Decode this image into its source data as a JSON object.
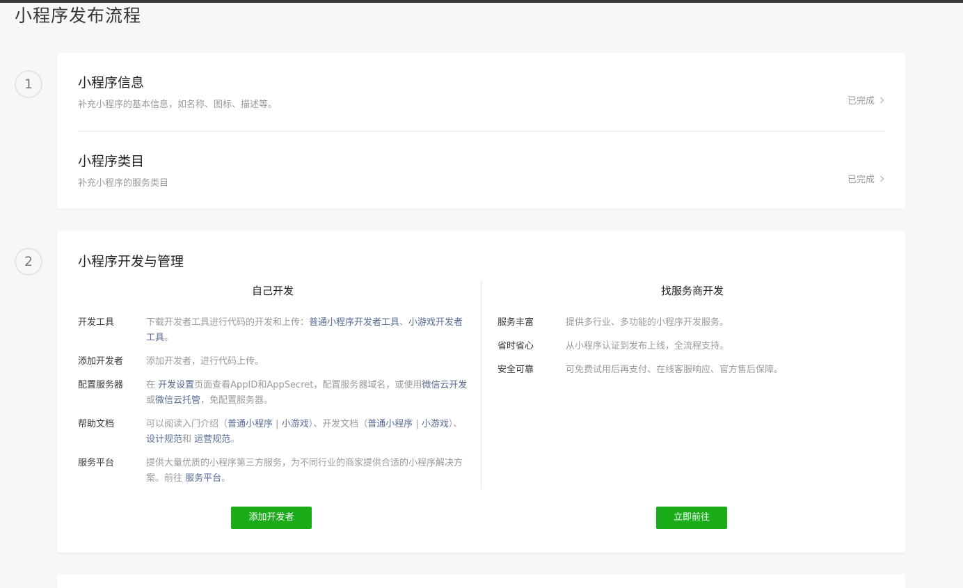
{
  "page": {
    "title": "小程序发布流程"
  },
  "step1": {
    "number": "1",
    "rows": [
      {
        "title": "小程序信息",
        "desc": "补充小程序的基本信息，如名称、图标、描述等。",
        "status": "已完成"
      },
      {
        "title": "小程序类目",
        "desc": "补充小程序的服务类目",
        "status": "已完成"
      }
    ]
  },
  "step2": {
    "number": "2",
    "title": "小程序开发与管理",
    "left": {
      "title": "自己开发",
      "items": [
        {
          "label": "开发工具",
          "t1": "下载开发者工具进行代码的开发和上传：",
          "l1": "普通小程序开发者工具",
          "t2": "、",
          "l2": "小游戏开发者工具",
          "t3": "。"
        },
        {
          "label": "添加开发者",
          "t1": "添加开发者，进行代码上传。"
        },
        {
          "label": "配置服务器",
          "t1": "在 ",
          "l1": "开发设置",
          "t2": "页面查看AppID和AppSecret，配置服务器域名，或使用",
          "l2": "微信云开发",
          "t3": "或",
          "l3": "微信云托管",
          "t4": "，免配置服务器。"
        },
        {
          "label": "帮助文档",
          "t1": "可以阅读入门介绍（",
          "l1": "普通小程序",
          "t2": " | ",
          "l2": "小游戏",
          "t3": "）、开发文档（",
          "l3": "普通小程序",
          "t4": " | ",
          "l4": "小游戏",
          "t5": "）、",
          "l5": "设计规范",
          "t6": "和 ",
          "l6": "运营规范",
          "t7": "。"
        },
        {
          "label": "服务平台",
          "t1": "提供大量优质的小程序第三方服务，为不同行业的商家提供合适的小程序解决方案。前往 ",
          "l1": "服务平台",
          "t2": "。"
        }
      ],
      "button": "添加开发者"
    },
    "right": {
      "title": "找服务商开发",
      "items": [
        {
          "label": "服务丰富",
          "text": "提供多行业、多功能的小程序开发服务。"
        },
        {
          "label": "省时省心",
          "text": "从小程序认证到发布上线，全流程支持。"
        },
        {
          "label": "安全可靠",
          "text": "可免费试用后再支付、在线客服响应、官方售后保障。"
        }
      ],
      "button": "立即前往"
    }
  },
  "colors": {
    "accent_green": "#1aad19",
    "link": "#576b95",
    "muted": "#9a9a9a"
  }
}
